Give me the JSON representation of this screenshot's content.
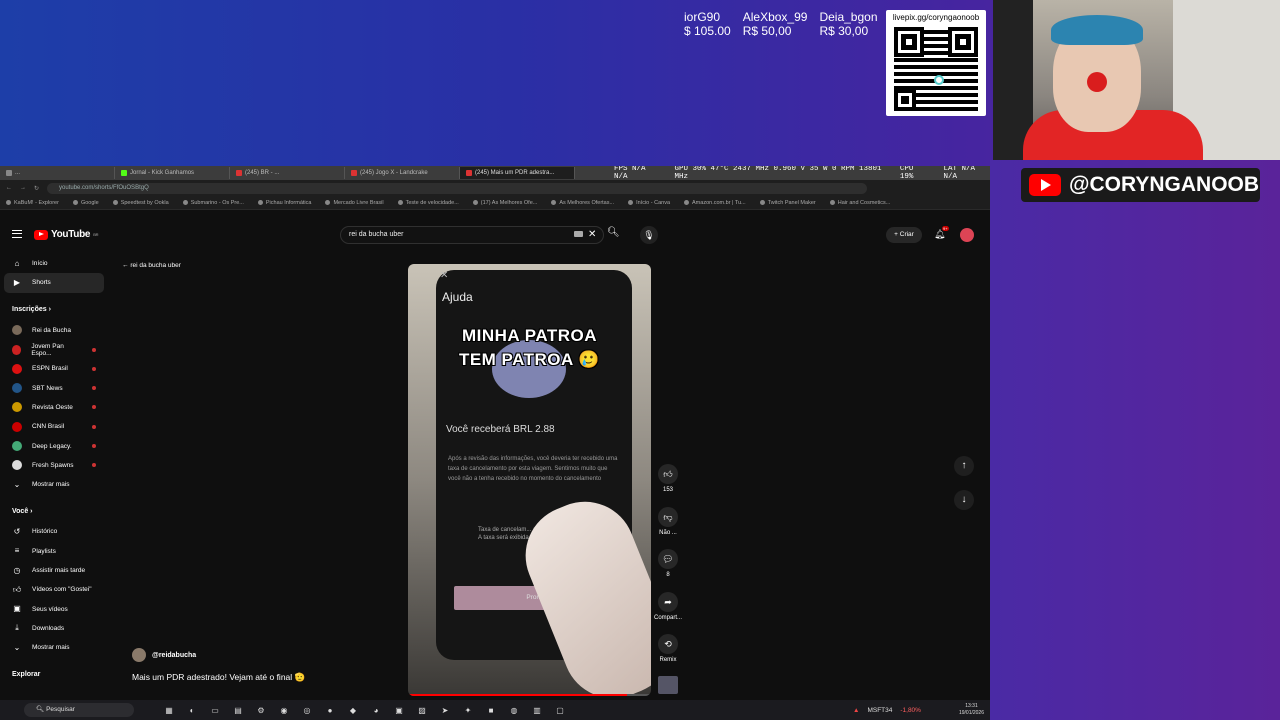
{
  "stream": {
    "donations": [
      {
        "name": "iorG90",
        "amount": "$ 105.00"
      },
      {
        "name": "AleXbox_99",
        "amount": "R$ 50,00"
      },
      {
        "name": "Deia_bgon",
        "amount": "R$ 30,00"
      }
    ],
    "qr_url": "livepix.gg/coryngaonoob",
    "handle": "@CORYNGANOOB"
  },
  "browser": {
    "tabs": [
      {
        "label": "..."
      },
      {
        "label": "Jornal - Kick Ganhamos"
      },
      {
        "label": "(245) BR - ..."
      },
      {
        "label": "(245) Jogo X - Landcrake"
      },
      {
        "label": "(245) Mais um PDR adestra...",
        "active": true
      }
    ],
    "overlay_stats": {
      "fps": "FPS  N/A  N/A",
      "gpu": "GPU 30% 47°C 2437 MHz 0.960 V 35 W 0 RPM 13801 MHz",
      "cpu": "CPU 19%",
      "lat": "LAT N/A N/A"
    },
    "url": "youtube.com/shorts/FfOuOSBtgQ",
    "bookmarks": [
      "KaBuM! - Explorer",
      "Google",
      "Speedtest by Ookla",
      "Submarino - Os Pre...",
      "Pichau Informática",
      "Mercado Livre Brasil",
      "Teste de velocidade...",
      "(17) As Melhores Ofe...",
      "As Melhores Ofertas...",
      "Início - Canva",
      "Amazon.com.br | Tu...",
      "Twitch Panel Maker",
      "Hair and Cosmetics..."
    ]
  },
  "youtube": {
    "logo": "YouTube",
    "logo_region": "BR",
    "search_value": "rei da bucha uber",
    "create_label": "Criar",
    "notif_count": "9+",
    "back_label": "rei da bucha uber",
    "sidebar": {
      "main": [
        {
          "label": "Início",
          "icon": "home-icon"
        },
        {
          "label": "Shorts",
          "icon": "shorts-icon",
          "selected": true
        }
      ],
      "subs_title": "Inscrições",
      "subs": [
        {
          "label": "Rei da Bucha",
          "color": "#7a6a5a",
          "live": false
        },
        {
          "label": "Jovem Pan Espo...",
          "color": "#c22",
          "live": true
        },
        {
          "label": "ESPN Brasil",
          "color": "#d11",
          "live": true
        },
        {
          "label": "SBT News",
          "color": "#258",
          "live": true
        },
        {
          "label": "Revista Oeste",
          "color": "#c90",
          "live": true
        },
        {
          "label": "CNN Brasil",
          "color": "#c00",
          "live": true
        },
        {
          "label": "Deep Legacy.",
          "color": "#4a7",
          "live": true
        },
        {
          "label": "Fresh Spawns",
          "color": "#ddd",
          "live": true
        }
      ],
      "subs_more": "Mostrar mais",
      "you_title": "Você",
      "you": [
        {
          "label": "Histórico",
          "icon": "history-icon"
        },
        {
          "label": "Playlists",
          "icon": "playlist-icon"
        },
        {
          "label": "Assistir mais tarde",
          "icon": "watch-later-icon"
        },
        {
          "label": "Vídeos com \"Gostei\"",
          "icon": "like-icon"
        },
        {
          "label": "Seus vídeos",
          "icon": "video-icon"
        },
        {
          "label": "Downloads",
          "icon": "download-icon"
        }
      ],
      "you_more": "Mostrar mais",
      "explore_title": "Explorar"
    },
    "video": {
      "ui_close": "✕",
      "ui_title": "Ajuda",
      "caption_line1": "MINHA PATROA",
      "caption_line2": "TEM PATROA 🥲",
      "receive": "Você receberá BRL 2.88",
      "info": "Após a revisão das informações, você deveria ter recebido uma taxa de cancelamento por esta viagem. Sentimos muito que você não a tenha recebido no momento do cancelamento",
      "taxa": "Taxa de cancelam... adicionada",
      "taxa_sub": "A taxa será exibida em... de ganhos",
      "done": "Pronto",
      "progress": 0.9
    },
    "actions": [
      {
        "icon": "like-icon",
        "label": "153"
      },
      {
        "icon": "dislike-icon",
        "label": "Não ..."
      },
      {
        "icon": "comment-icon",
        "label": "8"
      },
      {
        "icon": "share-icon",
        "label": "Compart..."
      },
      {
        "icon": "remix-icon",
        "label": "Remix"
      }
    ],
    "channel": "@reidabucha",
    "title": "Mais um PDR adestrado! Vejam até o final 🫡"
  },
  "taskbar": {
    "search": "Pesquisar",
    "stock_name": "MSFT34",
    "stock_change": "-1,80%",
    "time": "13:31",
    "date": "19/01/2026"
  }
}
